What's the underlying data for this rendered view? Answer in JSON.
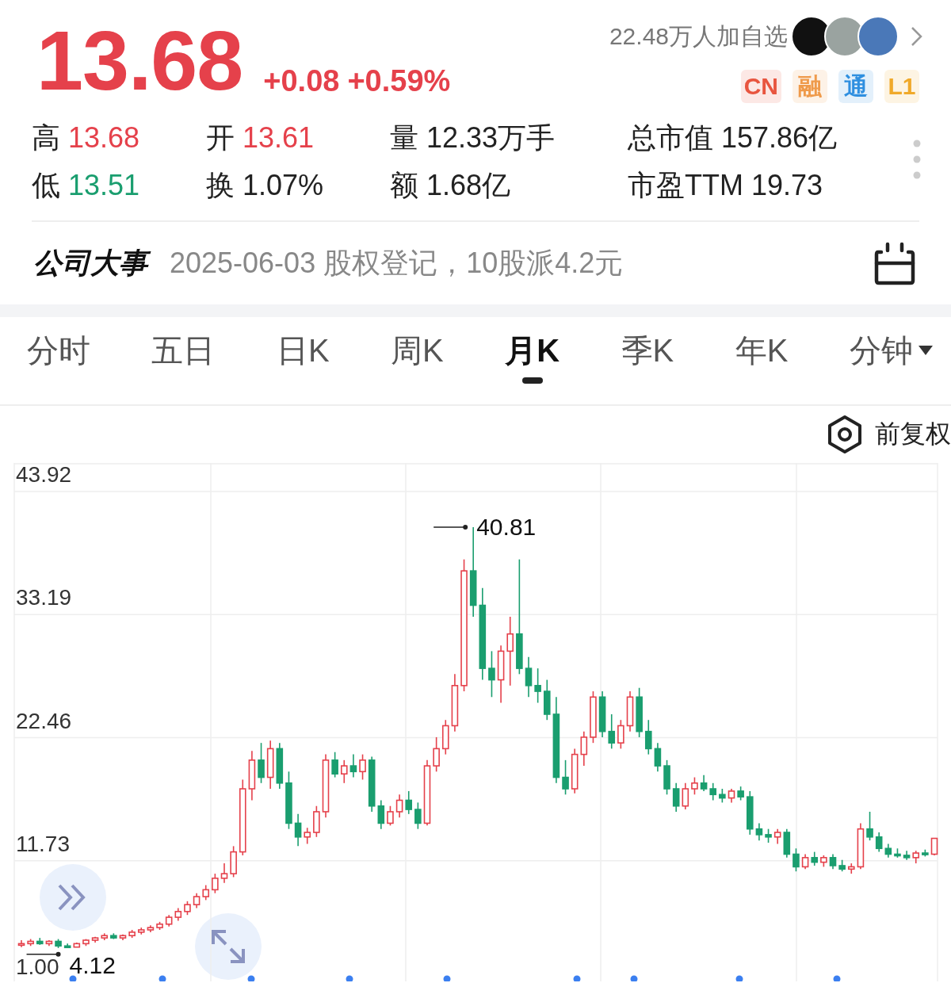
{
  "quote": {
    "price": "13.68",
    "change": "+0.08",
    "change_pct": "+0.59%",
    "kind": "rise"
  },
  "followers": {
    "text": "22.48万人加自选",
    "avatars": [
      {
        "color": "#111111"
      },
      {
        "color": "#9aa3a0"
      },
      {
        "color": "#4a78b8"
      }
    ]
  },
  "badges": [
    {
      "label": "CN",
      "color": "#e8553f"
    },
    {
      "label": "融",
      "color": "#ef9a4a"
    },
    {
      "label": "通",
      "color": "#2f8fe0"
    },
    {
      "label": "L1",
      "color": "#f0a92a"
    }
  ],
  "stats": [
    {
      "label": "高",
      "value": "13.68",
      "kind": "rise"
    },
    {
      "label": "开",
      "value": "13.61",
      "kind": "rise"
    },
    {
      "label": "量",
      "value": "12.33万手",
      "kind": "plain"
    },
    {
      "label": "总市值",
      "value": "157.86亿",
      "kind": "plain"
    },
    {
      "label": "低",
      "value": "13.51",
      "kind": "fall"
    },
    {
      "label": "换",
      "value": "1.07%",
      "kind": "plain"
    },
    {
      "label": "额",
      "value": "1.68亿",
      "kind": "plain"
    },
    {
      "label": "市盈TTM",
      "value": "19.73",
      "kind": "plain"
    }
  ],
  "event": {
    "title": "公司大事",
    "text": "2025-06-03 股权登记，10股派4.2元"
  },
  "tabs": [
    {
      "label": "分时",
      "selected": false,
      "menu": false
    },
    {
      "label": "五日",
      "selected": false,
      "menu": false
    },
    {
      "label": "日K",
      "selected": false,
      "menu": false
    },
    {
      "label": "周K",
      "selected": false,
      "menu": false
    },
    {
      "label": "月K",
      "selected": true,
      "menu": false
    },
    {
      "label": "季K",
      "selected": false,
      "menu": false
    },
    {
      "label": "年K",
      "selected": false,
      "menu": false
    },
    {
      "label": "分钟",
      "selected": false,
      "menu": true
    }
  ],
  "adjust": {
    "label": "前复权"
  },
  "chart": {
    "chart_data": {
      "type": "candlestick",
      "grid": true,
      "ylim": [
        1.0,
        43.92
      ],
      "yticks": [
        {
          "value": 43.92,
          "label": "43.92"
        },
        {
          "value": 33.19,
          "label": "33.19"
        },
        {
          "value": 22.46,
          "label": "22.46"
        },
        {
          "value": 11.73,
          "label": "11.73"
        },
        {
          "value": 1.0,
          "label": "1.00"
        }
      ],
      "annotations": [
        {
          "text": "40.81"
        },
        {
          "text": "4.12"
        }
      ],
      "ohlc": [
        [
          4.4,
          4.8,
          4.2,
          4.5
        ],
        [
          4.5,
          4.9,
          4.3,
          4.7
        ],
        [
          4.7,
          5.0,
          4.4,
          4.5
        ],
        [
          4.5,
          4.8,
          4.3,
          4.7
        ],
        [
          4.7,
          4.9,
          4.12,
          4.3
        ],
        [
          4.3,
          4.5,
          4.15,
          4.2
        ],
        [
          4.2,
          4.6,
          4.2,
          4.5
        ],
        [
          4.5,
          4.9,
          4.3,
          4.8
        ],
        [
          4.8,
          5.1,
          4.6,
          5.0
        ],
        [
          5.0,
          5.4,
          4.8,
          5.2
        ],
        [
          5.2,
          5.4,
          4.9,
          5.0
        ],
        [
          5.0,
          5.3,
          4.8,
          5.2
        ],
        [
          5.2,
          5.7,
          5.0,
          5.5
        ],
        [
          5.5,
          5.9,
          5.3,
          5.7
        ],
        [
          5.7,
          6.1,
          5.5,
          5.9
        ],
        [
          5.9,
          6.4,
          5.7,
          6.2
        ],
        [
          6.2,
          7.0,
          6.0,
          6.8
        ],
        [
          6.8,
          7.6,
          6.5,
          7.3
        ],
        [
          7.3,
          8.2,
          7.0,
          7.9
        ],
        [
          7.9,
          8.9,
          7.6,
          8.6
        ],
        [
          8.6,
          9.6,
          8.3,
          9.2
        ],
        [
          9.2,
          10.6,
          8.9,
          10.2
        ],
        [
          10.2,
          11.5,
          9.8,
          10.6
        ],
        [
          10.6,
          13.0,
          10.3,
          12.5
        ],
        [
          12.5,
          18.8,
          12.2,
          18.0
        ],
        [
          18.0,
          21.3,
          17.0,
          20.5
        ],
        [
          20.5,
          22.0,
          18.5,
          19.0
        ],
        [
          19.0,
          22.2,
          18.0,
          21.5
        ],
        [
          21.5,
          22.0,
          18.0,
          18.5
        ],
        [
          18.5,
          19.5,
          14.5,
          15.0
        ],
        [
          15.0,
          15.8,
          13.0,
          13.8
        ],
        [
          13.8,
          14.6,
          13.2,
          14.2
        ],
        [
          14.2,
          16.5,
          13.8,
          16.0
        ],
        [
          16.0,
          21.0,
          15.5,
          20.5
        ],
        [
          20.5,
          21.2,
          19.0,
          19.3
        ],
        [
          19.3,
          20.5,
          18.5,
          20.0
        ],
        [
          20.0,
          21.0,
          19.0,
          19.5
        ],
        [
          19.5,
          21.0,
          18.8,
          20.5
        ],
        [
          20.5,
          20.8,
          16.0,
          16.5
        ],
        [
          16.5,
          17.0,
          14.5,
          15.0
        ],
        [
          15.0,
          16.5,
          14.8,
          16.0
        ],
        [
          16.0,
          17.5,
          15.5,
          17.0
        ],
        [
          17.0,
          17.8,
          15.8,
          16.2
        ],
        [
          16.2,
          16.8,
          14.5,
          15.0
        ],
        [
          15.0,
          20.5,
          14.8,
          20.0
        ],
        [
          20.0,
          22.5,
          19.5,
          21.5
        ],
        [
          21.5,
          24.0,
          21.0,
          23.5
        ],
        [
          23.5,
          28.0,
          23.0,
          27.0
        ],
        [
          27.0,
          38.0,
          26.5,
          37.0
        ],
        [
          37.0,
          40.81,
          33.0,
          34.0
        ],
        [
          34.0,
          35.5,
          27.5,
          28.5
        ],
        [
          28.5,
          30.0,
          26.0,
          27.5
        ],
        [
          27.5,
          30.5,
          25.5,
          30.0
        ],
        [
          30.0,
          33.0,
          27.0,
          31.5
        ],
        [
          31.5,
          38.0,
          28.0,
          28.5
        ],
        [
          28.5,
          29.5,
          26.0,
          27.0
        ],
        [
          27.0,
          28.5,
          25.5,
          26.5
        ],
        [
          26.5,
          27.5,
          24.0,
          24.5
        ],
        [
          24.5,
          26.0,
          18.5,
          19.0
        ],
        [
          19.0,
          20.5,
          17.5,
          18.0
        ],
        [
          18.0,
          21.5,
          17.6,
          21.0
        ],
        [
          21.0,
          23.0,
          20.0,
          22.5
        ],
        [
          22.5,
          26.5,
          22.0,
          26.0
        ],
        [
          26.0,
          26.5,
          22.5,
          23.0
        ],
        [
          23.0,
          24.5,
          21.5,
          22.0
        ],
        [
          22.0,
          24.0,
          21.5,
          23.5
        ],
        [
          23.5,
          26.5,
          23.0,
          26.0
        ],
        [
          26.0,
          26.8,
          22.5,
          23.0
        ],
        [
          23.0,
          24.0,
          21.0,
          21.5
        ],
        [
          21.5,
          22.0,
          19.5,
          20.0
        ],
        [
          20.0,
          20.5,
          17.5,
          18.0
        ],
        [
          18.0,
          18.5,
          16.0,
          16.5
        ],
        [
          16.5,
          18.5,
          16.2,
          18.0
        ],
        [
          18.0,
          19.0,
          17.5,
          18.5
        ],
        [
          18.5,
          19.2,
          17.8,
          18.0
        ],
        [
          18.0,
          18.5,
          17.0,
          17.5
        ],
        [
          17.5,
          18.0,
          16.8,
          17.2
        ],
        [
          17.2,
          18.0,
          16.8,
          17.8
        ],
        [
          17.8,
          18.2,
          17.0,
          17.3
        ],
        [
          17.3,
          17.8,
          14.0,
          14.5
        ],
        [
          14.5,
          15.0,
          13.5,
          14.0
        ],
        [
          14.0,
          14.5,
          13.3,
          13.8
        ],
        [
          13.8,
          14.5,
          13.2,
          14.2
        ],
        [
          14.2,
          14.5,
          12.0,
          12.3
        ],
        [
          12.3,
          12.8,
          10.8,
          11.2
        ],
        [
          11.2,
          12.3,
          11.0,
          12.0
        ],
        [
          12.0,
          12.5,
          11.3,
          11.6
        ],
        [
          11.6,
          12.2,
          11.2,
          12.0
        ],
        [
          12.0,
          12.3,
          11.0,
          11.3
        ],
        [
          11.3,
          11.8,
          10.8,
          11.0
        ],
        [
          11.0,
          11.5,
          10.6,
          11.2
        ],
        [
          11.2,
          15.0,
          11.0,
          14.5
        ],
        [
          14.5,
          16.0,
          13.5,
          13.8
        ],
        [
          13.8,
          14.2,
          12.5,
          12.8
        ],
        [
          12.8,
          13.2,
          12.0,
          12.3
        ],
        [
          12.3,
          12.8,
          12.0,
          12.2
        ],
        [
          12.2,
          12.6,
          11.8,
          12.0
        ],
        [
          12.0,
          12.6,
          11.5,
          12.4
        ],
        [
          12.4,
          12.7,
          12.1,
          12.3
        ],
        [
          12.3,
          13.7,
          12.2,
          13.68
        ]
      ]
    }
  }
}
